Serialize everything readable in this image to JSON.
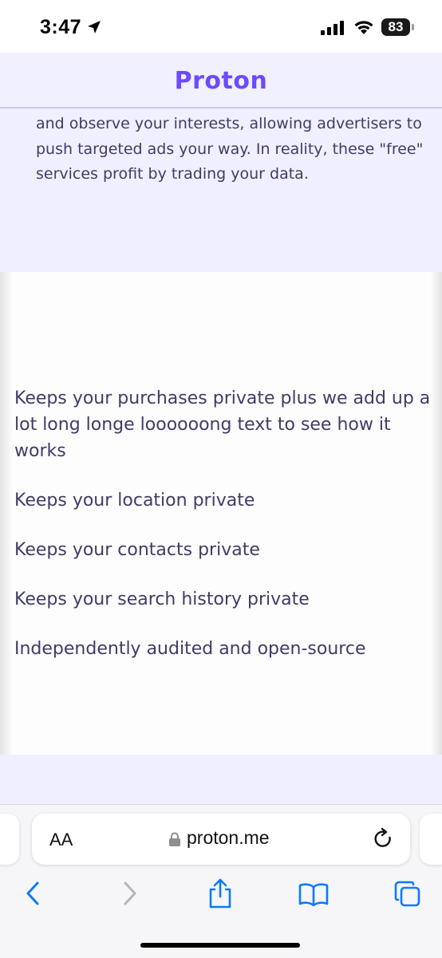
{
  "status_bar": {
    "time": "3:47",
    "battery": "83",
    "icons": [
      "location-arrow-icon",
      "cellular-signal-icon",
      "wifi-icon",
      "battery-icon"
    ]
  },
  "header": {
    "logo": "Proton",
    "brand_color": "#6d4aff"
  },
  "intro": {
    "text": "and observe your interests, allowing advertisers to push targeted ads your way. In reality, these \"free\" services profit by trading your data."
  },
  "features": {
    "items": [
      "Keeps your purchases private plus we add up a lot long longe loooooong text to see how it works",
      "Keeps your location private",
      "Keeps your contacts private",
      "Keeps your search history private",
      "Independently audited and open-source"
    ]
  },
  "browser": {
    "text_size_label": "AA",
    "url": "proton.me",
    "toolbar_icons": [
      "back-icon",
      "forward-icon",
      "share-icon",
      "bookmarks-icon",
      "tabs-icon"
    ]
  },
  "colors": {
    "text": "#3f3c66",
    "section_bg": "#f0efff",
    "link_blue": "#0a7aff"
  }
}
